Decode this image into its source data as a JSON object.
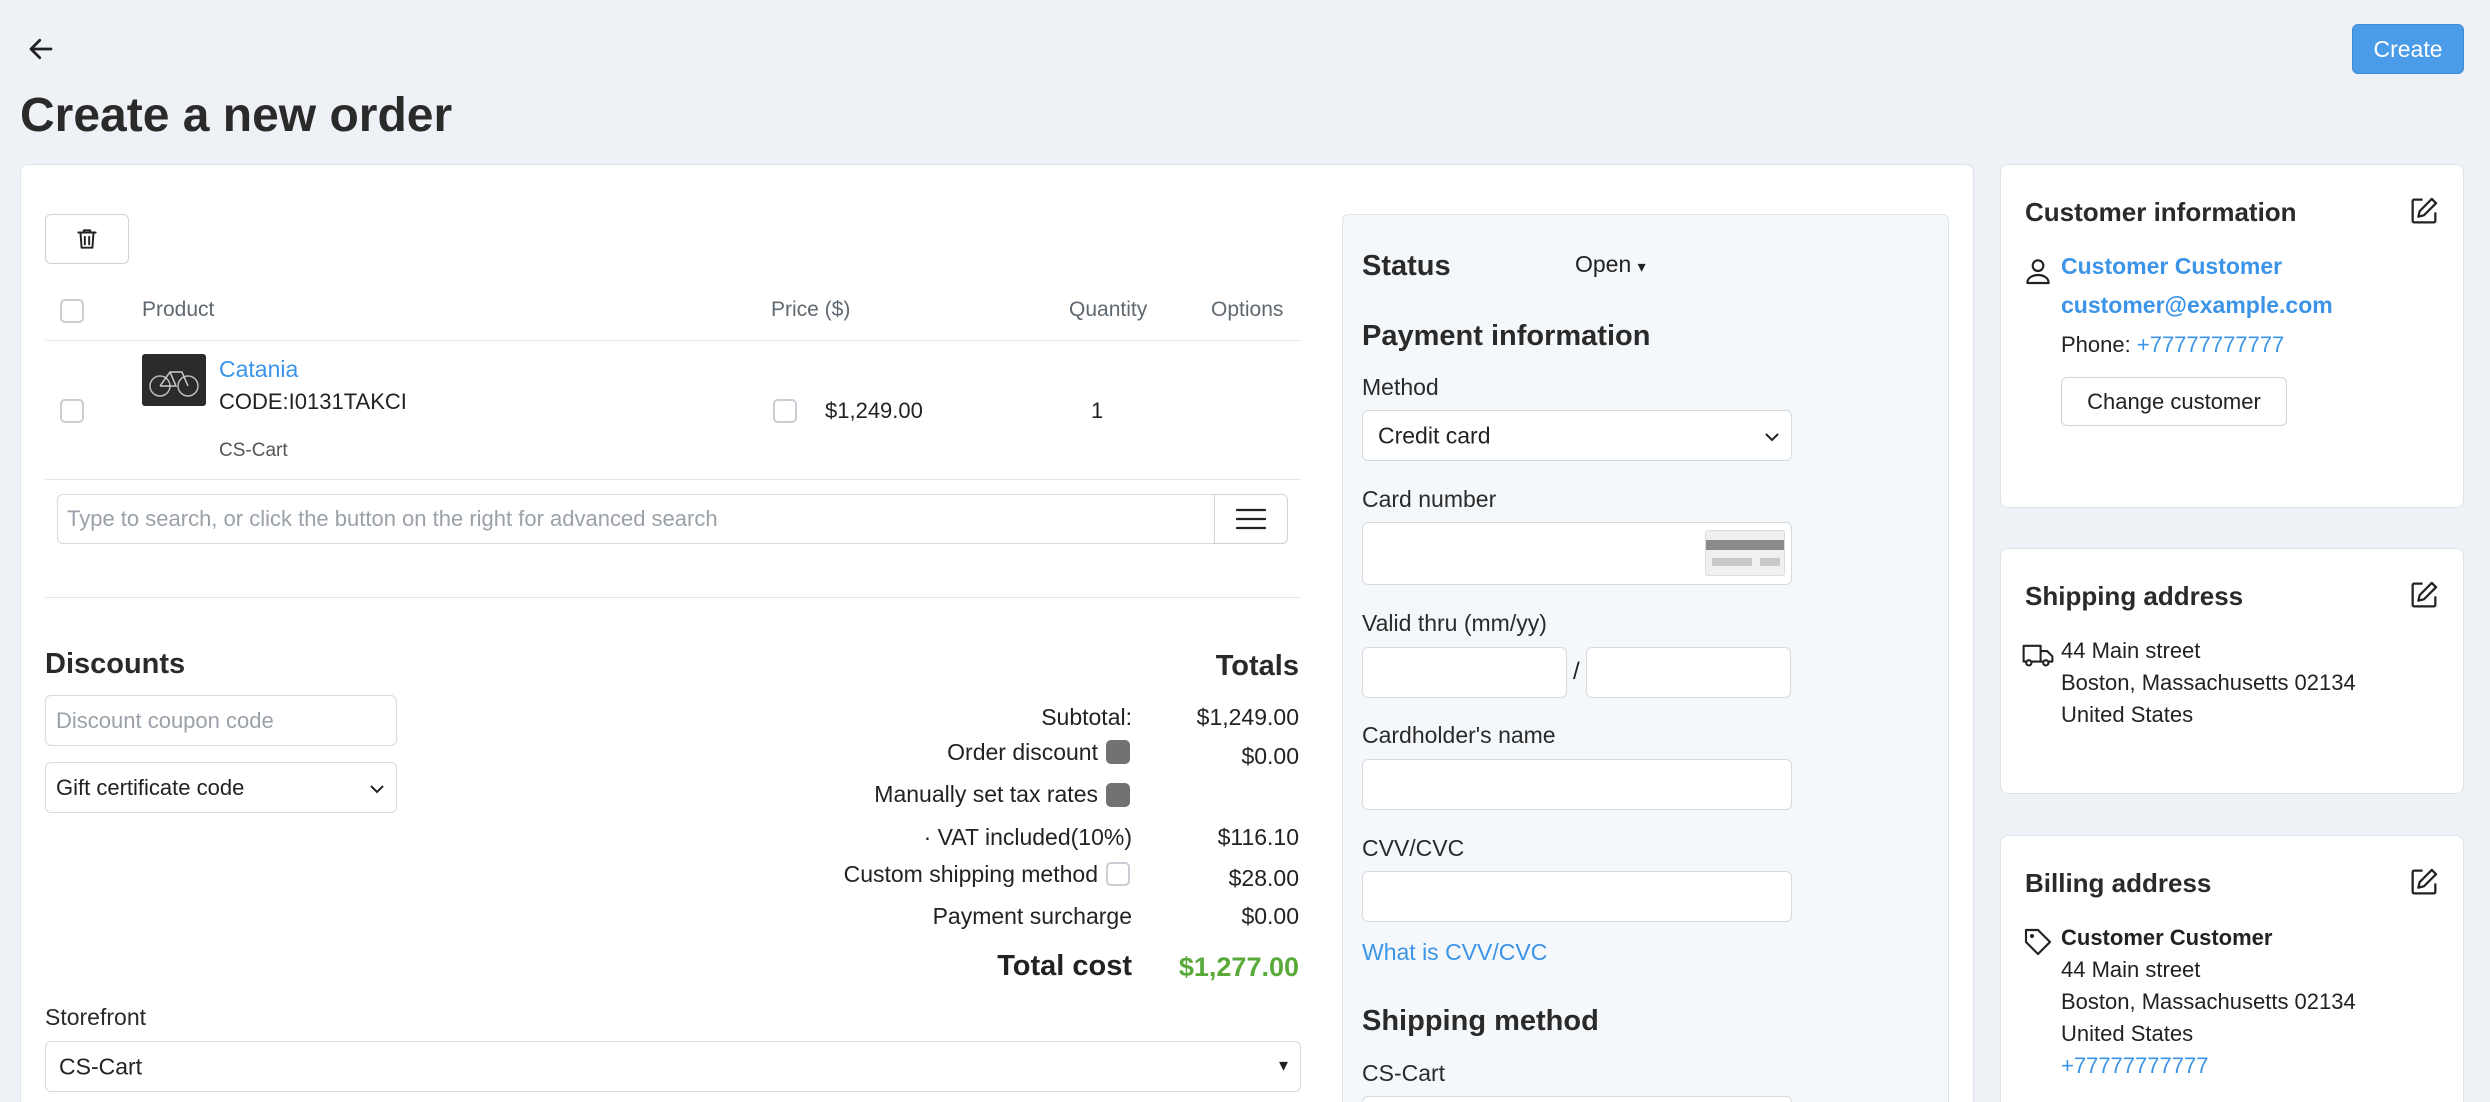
{
  "header": {
    "title": "Create a new order",
    "create_label": "Create"
  },
  "products": {
    "columns": {
      "product": "Product",
      "price": "Price ($)",
      "quantity": "Quantity",
      "options": "Options"
    },
    "rows": [
      {
        "name": "Catania",
        "code": "CODE:I0131TAKCI",
        "vendor": "CS-Cart",
        "price": "$1,249.00",
        "quantity": "1"
      }
    ],
    "search_placeholder": "Type to search, or click the button on the right for advanced search"
  },
  "discounts": {
    "title": "Discounts",
    "coupon_placeholder": "Discount coupon code",
    "gift_label": "Gift certificate code"
  },
  "totals": {
    "title": "Totals",
    "subtotal_label": "Subtotal:",
    "subtotal": "$1,249.00",
    "order_discount_label": "Order discount",
    "order_discount": "$0.00",
    "manual_tax_label": "Manually set tax rates",
    "vat_label": "· VAT included(10%)",
    "vat": "$116.10",
    "custom_shipping_label": "Custom shipping method",
    "custom_shipping": "$28.00",
    "surcharge_label": "Payment surcharge",
    "surcharge": "$0.00",
    "total_label": "Total cost",
    "total": "$1,277.00",
    "total_color": "#5aaa3b"
  },
  "storefront": {
    "label": "Storefront",
    "value": "CS-Cart"
  },
  "status": {
    "label": "Status",
    "value": "Open"
  },
  "payment": {
    "title": "Payment information",
    "method_label": "Method",
    "method_value": "Credit card",
    "card_number_label": "Card number",
    "valid_thru_label": "Valid thru (mm/yy)",
    "valid_sep": "/",
    "cardholder_label": "Cardholder's name",
    "cvv_label": "CVV/CVC",
    "cvv_help": "What is CVV/CVC"
  },
  "shipping_method": {
    "title": "Shipping method",
    "vendor": "CS-Cart"
  },
  "customer": {
    "title": "Customer information",
    "name": "Customer Customer",
    "email": "customer@example.com",
    "phone_label": "Phone:",
    "phone": "+77777777777",
    "change_label": "Change customer"
  },
  "shipping_address": {
    "title": "Shipping address",
    "line1": "44 Main street",
    "line2": "Boston, Massachusetts 02134",
    "line3": "United States"
  },
  "billing_address": {
    "title": "Billing address",
    "name": "Customer Customer",
    "line1": "44 Main street",
    "line2": "Boston, Massachusetts 02134",
    "line3": "United States",
    "phone": "+77777777777"
  },
  "icons": {
    "back": "arrow-left-icon",
    "trash": "trash-icon",
    "menu": "menu-icon",
    "edit": "edit-icon",
    "user": "user-icon",
    "truck": "truck-icon",
    "tag": "tag-icon"
  },
  "colors": {
    "accent": "#3b94e8",
    "create_button": "#4a9be8",
    "page_bg": "#eef2f7"
  }
}
